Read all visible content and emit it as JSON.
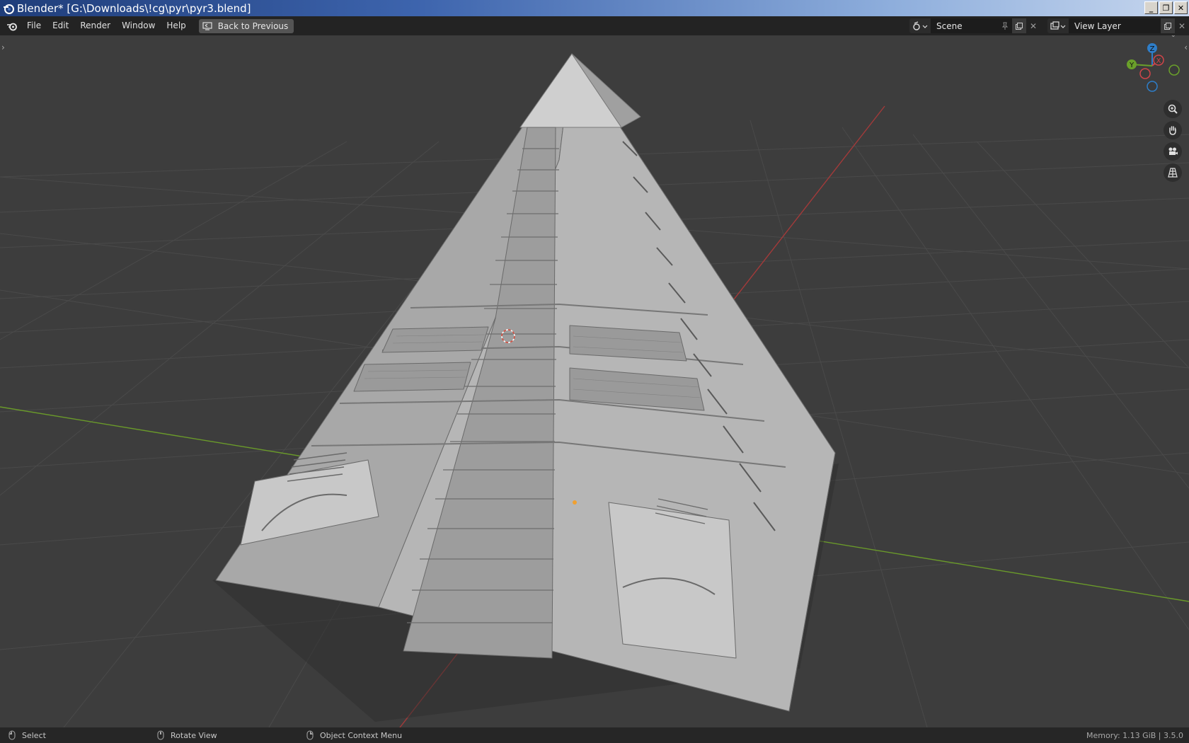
{
  "window": {
    "title": "Blender* [G:\\Downloads\\!cg\\pyr\\pyr3.blend]",
    "controls": [
      "_",
      "❐",
      "✕"
    ]
  },
  "menubar": {
    "items": [
      "File",
      "Edit",
      "Render",
      "Window",
      "Help"
    ],
    "back_button": "Back to Previous",
    "scene_field": "Scene",
    "view_layer_field": "View Layer"
  },
  "viewport": {
    "gizmo": {
      "z": "Z",
      "x": "X",
      "y": "Y"
    },
    "nav_buttons": [
      "zoom-icon",
      "hand-pan-icon",
      "camera-icon",
      "grid-perspective-icon"
    ]
  },
  "statusbar": {
    "select": "Select",
    "rotate": "Rotate View",
    "context": "Object Context Menu",
    "memory": "Memory: 1.13 GiB | 3.5.0"
  },
  "colors": {
    "viewport_bg": "#3d3d3d",
    "grid_line": "#4a4a4a",
    "x_axis": "#a33a3a",
    "y_axis": "#6a9a2a",
    "model": "#b9b9b9",
    "title_gradient_start": "#1f3d7a"
  }
}
